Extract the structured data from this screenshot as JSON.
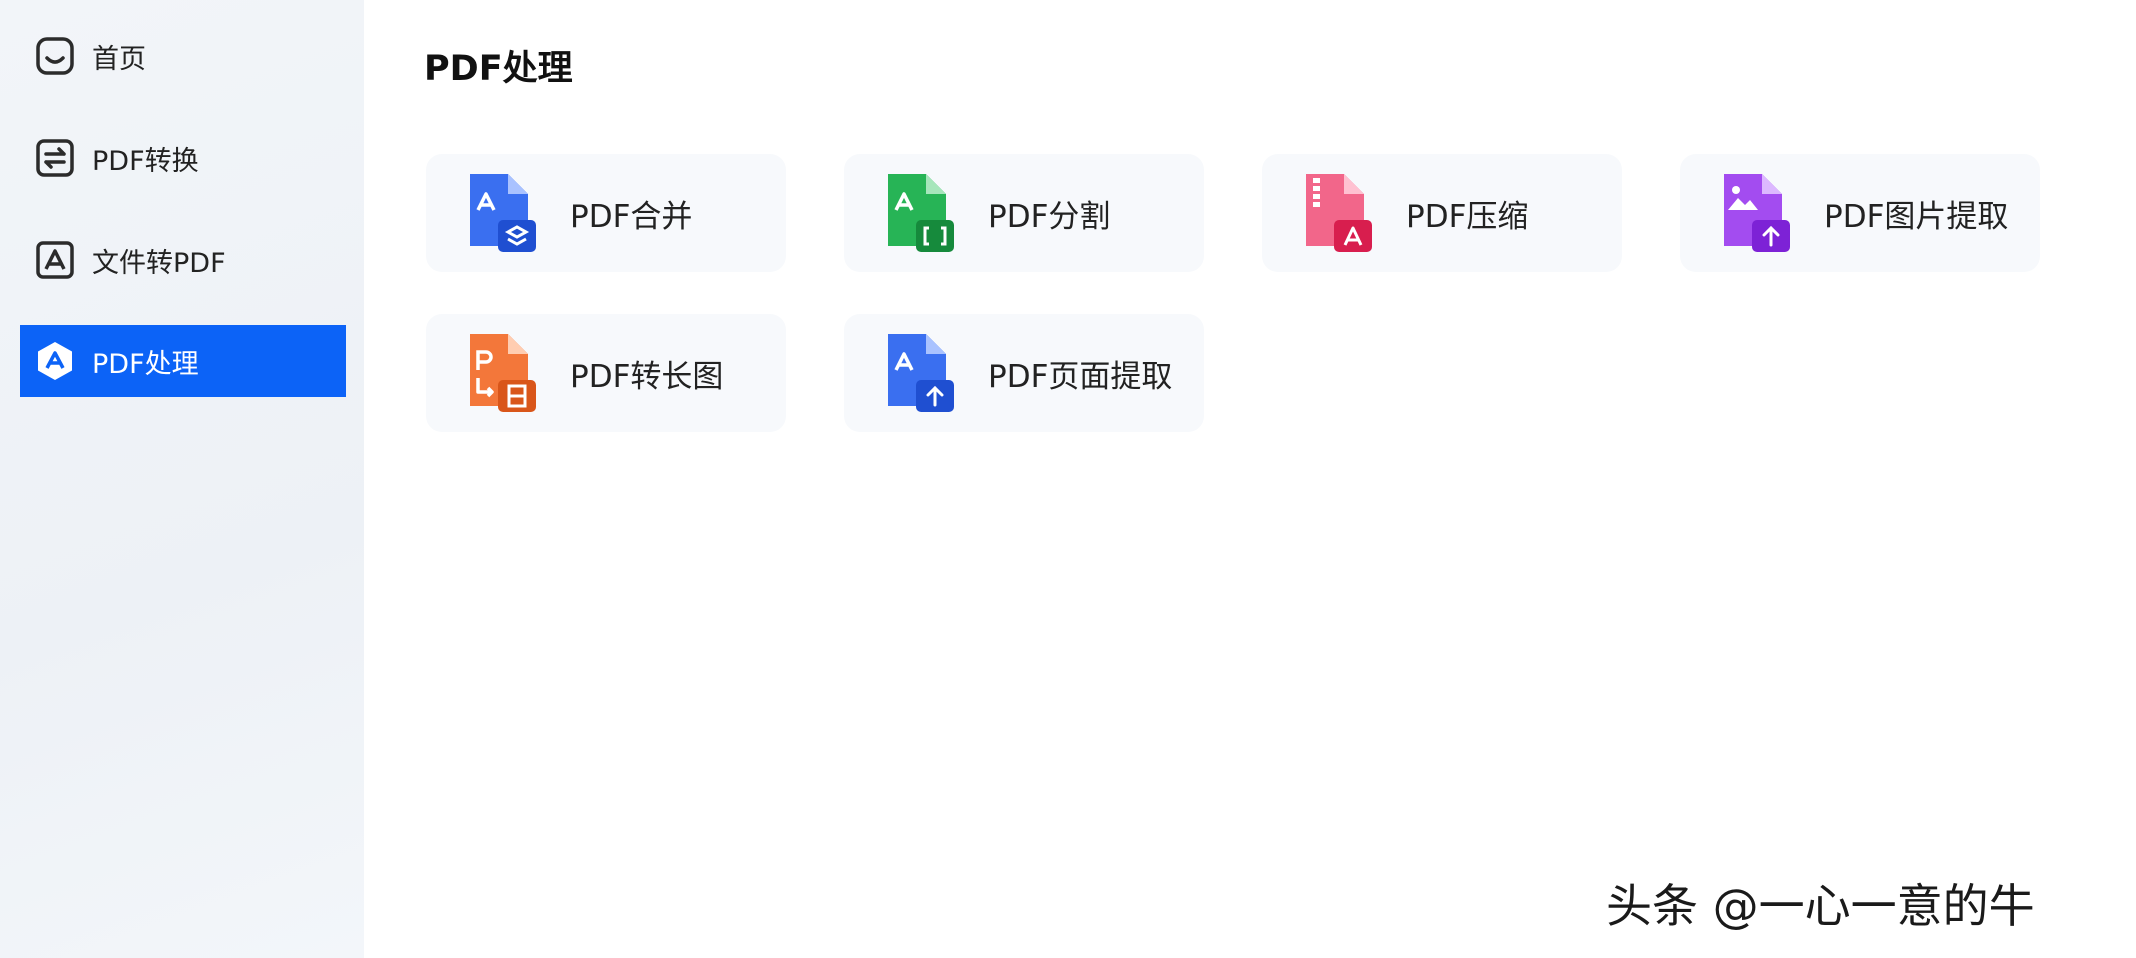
{
  "sidebar": {
    "items": [
      {
        "label": "首页",
        "icon": "home-icon",
        "active": false
      },
      {
        "label": "PDF转换",
        "icon": "convert-icon",
        "active": false
      },
      {
        "label": "文件转PDF",
        "icon": "file-to-pdf-icon",
        "active": false
      },
      {
        "label": "PDF处理",
        "icon": "pdf-process-icon",
        "active": true
      }
    ],
    "active_color": "#0c63f7"
  },
  "main": {
    "title": "PDF处理",
    "tools": [
      {
        "label": "PDF合并",
        "icon": "pdf-merge-icon",
        "color": "#2f63e8"
      },
      {
        "label": "PDF分割",
        "icon": "pdf-split-icon",
        "color": "#1fa84a"
      },
      {
        "label": "PDF压缩",
        "icon": "pdf-compress-icon",
        "color": "#e0305c"
      },
      {
        "label": "PDF图片提取",
        "icon": "pdf-image-extract-icon",
        "color": "#9b3fe6"
      },
      {
        "label": "PDF转长图",
        "icon": "pdf-to-long-image-icon",
        "color": "#f06a22"
      },
      {
        "label": "PDF页面提取",
        "icon": "pdf-page-extract-icon",
        "color": "#2f63e8"
      }
    ]
  },
  "watermark": "头条 @一心一意的牛"
}
